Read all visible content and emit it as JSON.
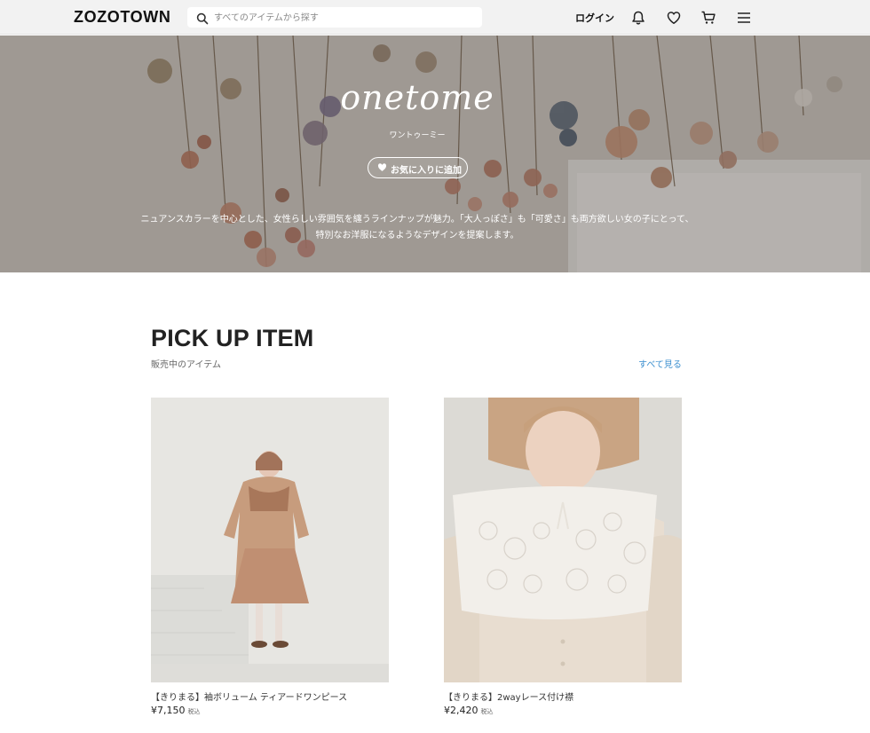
{
  "header": {
    "logo": "ZOZOTOWN",
    "search_placeholder": "すべてのアイテムから探す",
    "login": "ログイン"
  },
  "hero": {
    "brand": "onetome",
    "brand_kana": "ワントゥーミー",
    "favorite_button": "お気に入りに追加",
    "description_line1": "ニュアンスカラーを中心とした、女性らしい雰囲気を纏うラインナップが魅力。「大人っぽさ」も「可愛さ」も両方欲しい女の子にとって、",
    "description_line2": "特別なお洋服になるようなデザインを提案します。"
  },
  "pickup": {
    "title": "PICK UP ITEM",
    "subtitle": "販売中のアイテム",
    "see_all": "すべて見る",
    "items": [
      {
        "name": "【きりまる】袖ボリューム ティアードワンピース",
        "price": "¥7,150",
        "tax": "税込"
      },
      {
        "name": "【きりまる】2wayレース付け襟",
        "price": "¥2,420",
        "tax": "税込"
      }
    ]
  },
  "colors": {
    "header_bg": "#f2f2f2",
    "link": "#3b8fcf",
    "text": "#222222"
  },
  "icons": [
    "search-icon",
    "bell-icon",
    "heart-icon",
    "cart-icon",
    "menu-icon"
  ]
}
